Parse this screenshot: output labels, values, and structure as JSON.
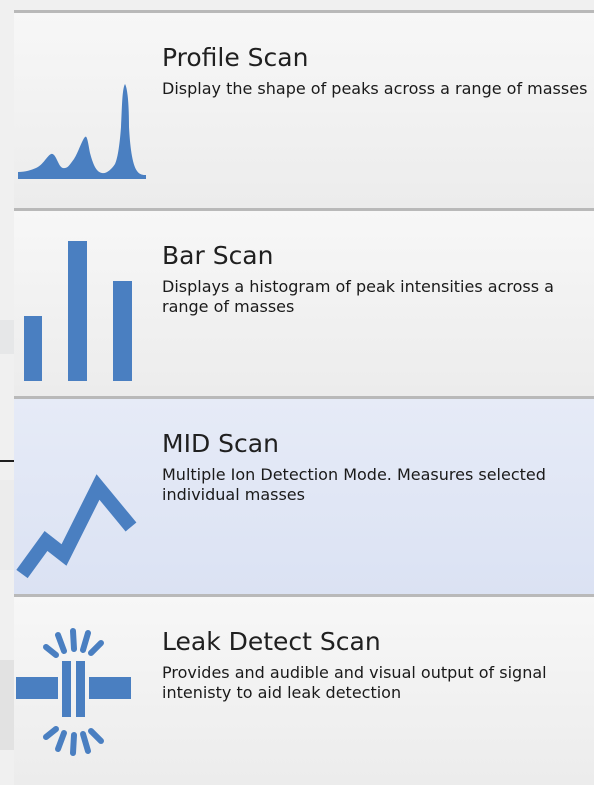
{
  "scan_modes": [
    {
      "title": "Profile Scan",
      "description": "Display the shape of peaks across a range of masses",
      "icon": "profile-peaks-icon",
      "selected": false
    },
    {
      "title": "Bar Scan",
      "description": "Displays a histogram of peak intensities across a range of masses",
      "icon": "bar-histogram-icon",
      "selected": false
    },
    {
      "title": "MID Scan",
      "description": "Multiple Ion Detection Mode. Measures selected individual masses",
      "icon": "mid-zigzag-icon",
      "selected": true
    },
    {
      "title": "Leak Detect Scan",
      "description": "Provides and audible and visual output of signal intenisty to aid leak detection",
      "icon": "leak-pipe-icon",
      "selected": false
    }
  ],
  "colors": {
    "icon": "#4a7fc1",
    "selected_background": "#dde4f4",
    "item_background": "#efefef",
    "divider": "#b9b9b9"
  }
}
